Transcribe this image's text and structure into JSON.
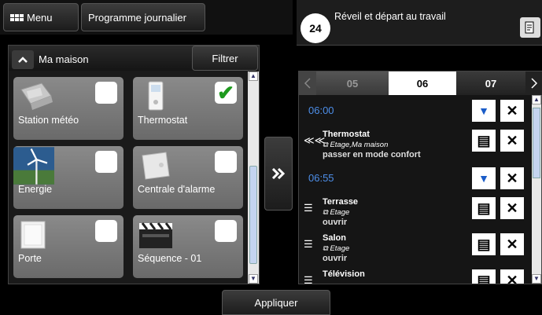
{
  "toolbar": {
    "menu_label": "Menu",
    "program_label": "Programme journalier"
  },
  "home": {
    "title": "Ma maison",
    "filter_label": "Filtrer"
  },
  "devices": [
    {
      "label": "Station météo",
      "checked": false
    },
    {
      "label": "Thermostat",
      "checked": true
    },
    {
      "label": "Energie",
      "checked": false
    },
    {
      "label": "Centrale d'alarme",
      "checked": false
    },
    {
      "label": "Porte",
      "checked": false
    },
    {
      "label": "Séquence - 01",
      "checked": false
    }
  ],
  "check_mark": "✔",
  "scenario": {
    "badge": "24",
    "title": "Réveil et départ au travail"
  },
  "days": [
    "05",
    "06",
    "07"
  ],
  "events": {
    "t1": "06:00",
    "e1": {
      "name": "Thermostat",
      "loc": "Etage,Ma maison",
      "action": "passer en mode confort"
    },
    "t2": "06:55",
    "e2": {
      "name": "Terrasse",
      "loc": "Etage",
      "action": "ouvrir"
    },
    "e3": {
      "name": "Salon",
      "loc": "Etage",
      "action": "ouvrir"
    },
    "e4": {
      "name": "Télévision"
    }
  },
  "apply_label": "Appliquer",
  "colors": {
    "time_blue": "#4d8ee8",
    "check_green": "#1e9a1e"
  }
}
